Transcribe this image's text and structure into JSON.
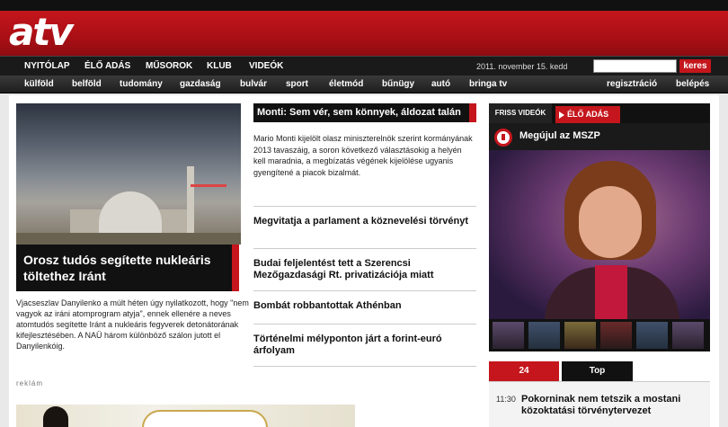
{
  "header": {
    "logo_text": "atv"
  },
  "nav_primary": {
    "items": [
      "NYITÓLAP",
      "ÉLŐ ADÁS",
      "MŰSOROK",
      "KLUB",
      "VIDEÓK"
    ],
    "date": "2011. november 15. kedd",
    "search_placeholder": "",
    "search_button": "keres"
  },
  "nav_secondary": {
    "items": [
      "külföld",
      "belföld",
      "tudomány",
      "gazdaság",
      "bulvár",
      "sport",
      "életmód",
      "bűnügy",
      "autó",
      "bringa tv"
    ],
    "register": "regisztráció",
    "login": "belépés"
  },
  "hero": {
    "title": "Orosz tudós segítette nukleáris töltethez Iránt",
    "text": "Vjacseszlav Danyilenko a múlt héten úgy nyilatkozott, hogy \"nem vagyok az iráni atomprogram atyja\", ennek ellenére a neves atomtudós segítette Iránt a nukleáris fegyverek detonátorának kifejlesztésében. A NAÜ három különböző szálon jutott el Danyilenkóig."
  },
  "ad": {
    "label": "reklám"
  },
  "middle": {
    "lead_title": "Monti: Sem vér, sem könnyek, áldozat talán",
    "lead_text": "Mario Monti kijelölt olasz miniszterelnök szerint kormányának 2013 tavaszáig, a soron következő választásokig a helyén kell maradnia, a megbízatás végének kijelölése ugyanis gyengítené a piacok bizalmát.",
    "items": [
      "Megvitatja a parlament a köznevelési törvényt",
      "Budai feljelentést tett a Szerencsi Mezőgazdasági Rt. privatizációja miatt",
      "Bombát robbantottak Athénban",
      "Történelmi mélyponton járt a forint-euró árfolyam"
    ]
  },
  "video": {
    "tab_recent": "FRISS VIDEÓK",
    "tab_live": "ÉLŐ ADÁS",
    "title": "Megújul az MSZP"
  },
  "news": {
    "tab_24": "24",
    "tab_top": "Top",
    "items": [
      {
        "time": "11:30",
        "title": "Pokorninak nem tetszik a mostani közoktatási törvénytervezet"
      }
    ]
  },
  "colors": {
    "brand_red": "#c4161c",
    "dark": "#111111"
  }
}
